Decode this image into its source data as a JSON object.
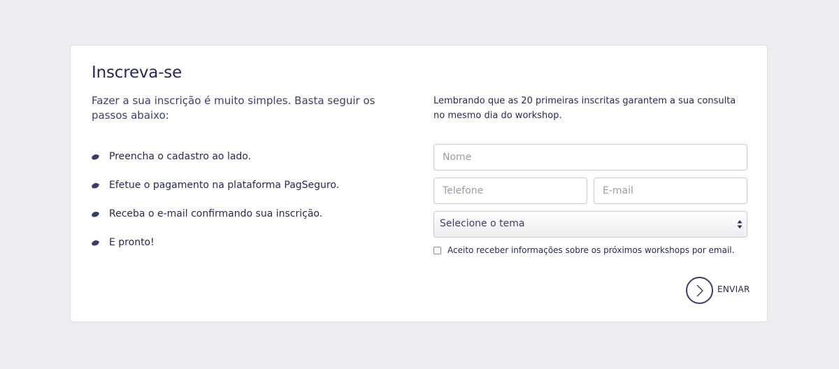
{
  "form": {
    "title": "Inscreva-se",
    "intro": "Fazer a sua inscrição é muito simples. Basta seguir os passos abaixo:",
    "note": "Lembrando que as 20 primeiras inscritas garantem a sua consulta no mesmo dia do workshop.",
    "steps": [
      {
        "label": "Preencha o cadastro ao lado."
      },
      {
        "label": "Efetue o pagamento na plataforma PagSeguro."
      },
      {
        "label": "Receba o e-mail confirmando sua inscrição."
      },
      {
        "label": "E pronto!"
      }
    ],
    "fields": {
      "name": {
        "value": "",
        "placeholder": "Nome"
      },
      "phone": {
        "value": "",
        "placeholder": "Telefone"
      },
      "email": {
        "value": "",
        "placeholder": "E-mail"
      }
    },
    "theme_select": {
      "selected": "Selecione o tema"
    },
    "consent": {
      "label": "Aceito receber informações sobre os próximos workshops por email.",
      "checked": false
    },
    "submit": {
      "label": "ENVIAR",
      "icon": "chevron-right-icon"
    }
  },
  "colors": {
    "page_background": "#ececf1",
    "card_background": "#ffffff",
    "text_primary": "#262a52",
    "border": "#c9c9d2"
  }
}
